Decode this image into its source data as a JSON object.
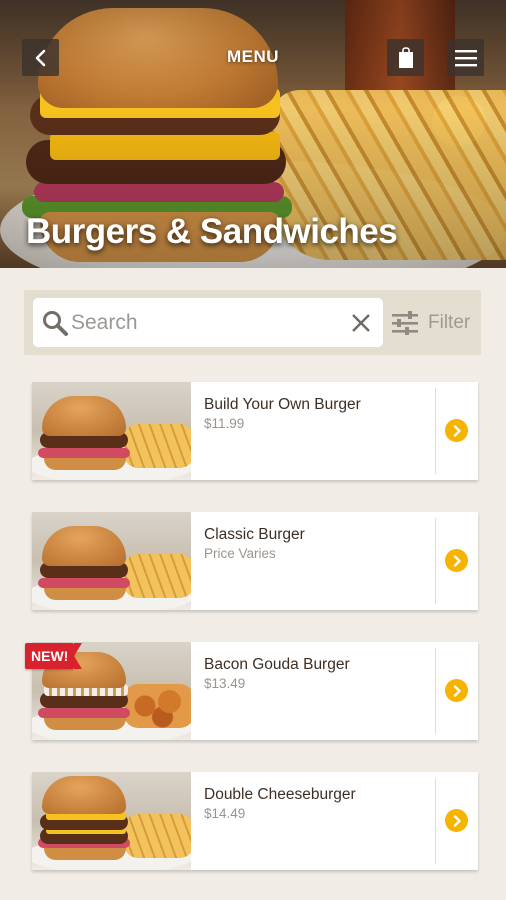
{
  "header": {
    "title": "MENU",
    "back_icon": "chevron-left-icon",
    "bag_icon": "shopping-bag-icon",
    "menu_icon": "hamburger-menu-icon"
  },
  "hero": {
    "title": "Burgers & Sandwiches"
  },
  "search": {
    "placeholder": "Search",
    "value": "",
    "filter_label": "Filter"
  },
  "items": [
    {
      "name": "Build Your Own Burger",
      "price": "$11.99",
      "badge": ""
    },
    {
      "name": "Classic Burger",
      "price": "Price Varies",
      "badge": ""
    },
    {
      "name": "Bacon Gouda Burger",
      "price": "$13.49",
      "badge": "NEW!"
    },
    {
      "name": "Double Cheeseburger",
      "price": "$14.49",
      "badge": ""
    }
  ],
  "colors": {
    "accent": "#f6b300",
    "badge": "#d8232e",
    "background": "#f1ede6",
    "search_bar": "#e3ded0"
  }
}
